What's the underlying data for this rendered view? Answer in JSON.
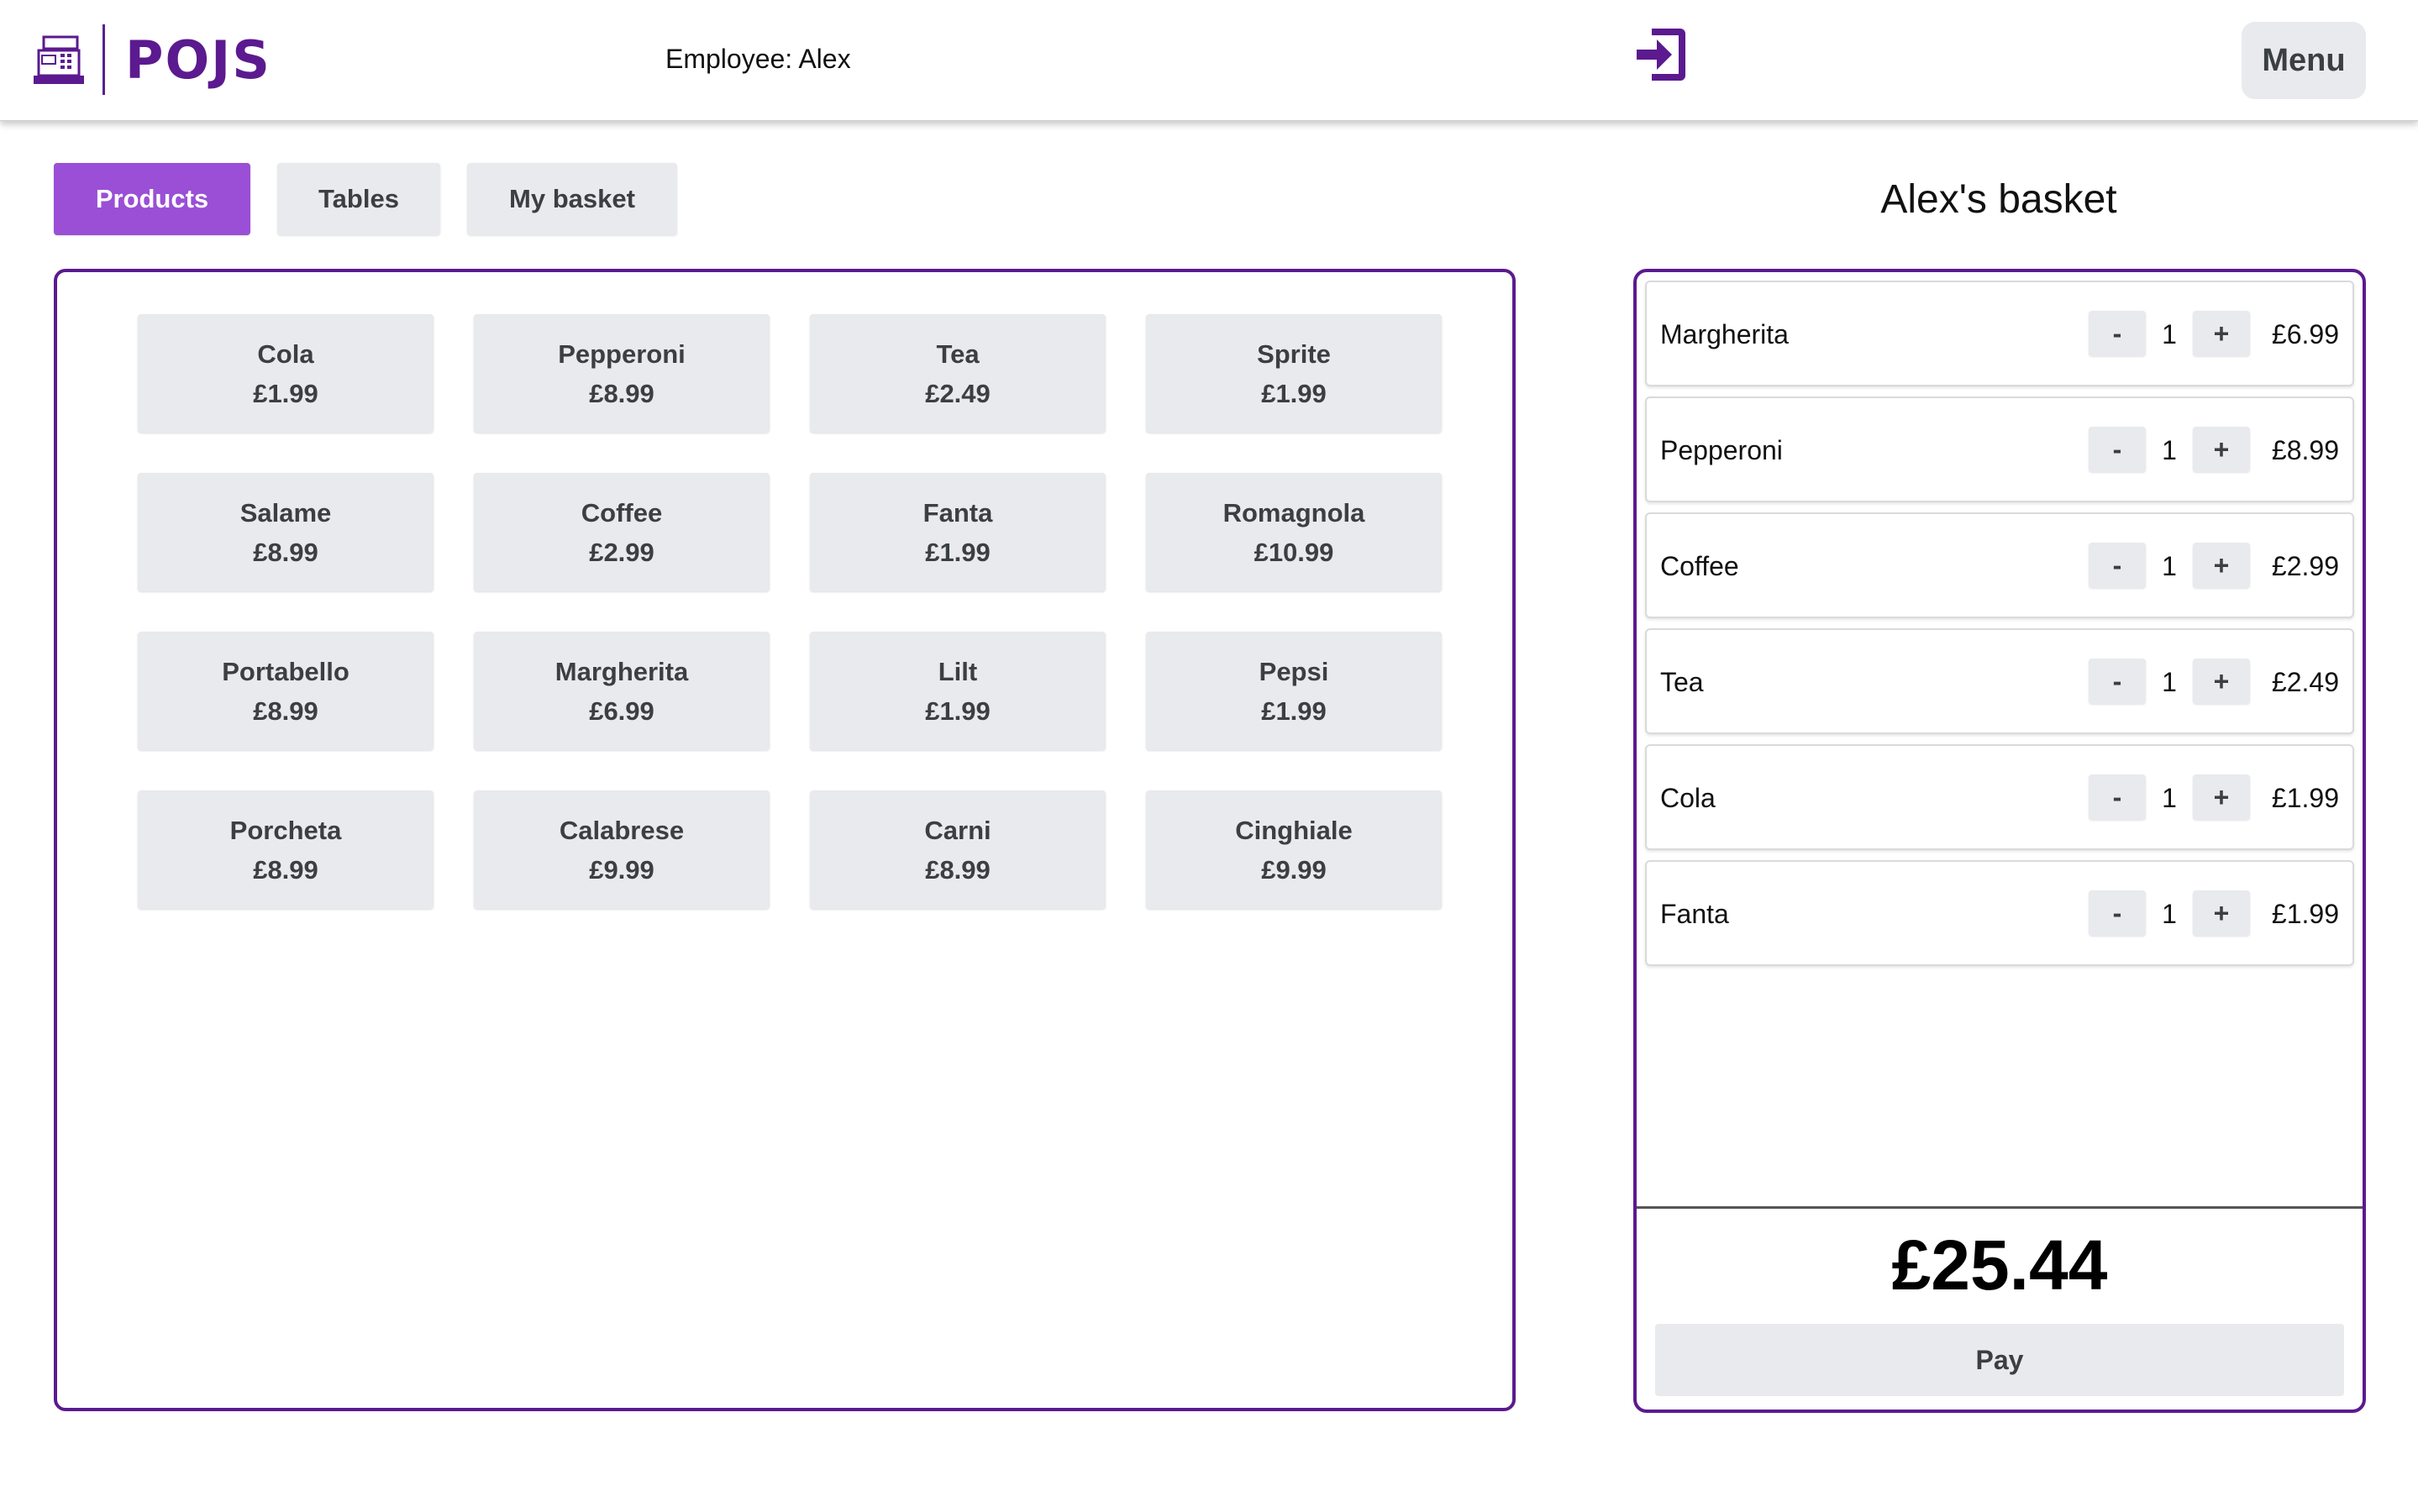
{
  "app": {
    "name": "POJS",
    "employee_label": "Employee: Alex",
    "menu_label": "Menu"
  },
  "colors": {
    "accent": "#9a4fd6",
    "brand": "#5b1a8f",
    "button_bg": "#e8eaed"
  },
  "tabs": [
    {
      "label": "Products",
      "active": true
    },
    {
      "label": "Tables",
      "active": false
    },
    {
      "label": "My basket",
      "active": false
    }
  ],
  "products": [
    {
      "name": "Cola",
      "price": "£1.99"
    },
    {
      "name": "Pepperoni",
      "price": "£8.99"
    },
    {
      "name": "Tea",
      "price": "£2.49"
    },
    {
      "name": "Sprite",
      "price": "£1.99"
    },
    {
      "name": "Salame",
      "price": "£8.99"
    },
    {
      "name": "Coffee",
      "price": "£2.99"
    },
    {
      "name": "Fanta",
      "price": "£1.99"
    },
    {
      "name": "Romagnola",
      "price": "£10.99"
    },
    {
      "name": "Portabello",
      "price": "£8.99"
    },
    {
      "name": "Margherita",
      "price": "£6.99"
    },
    {
      "name": "Lilt",
      "price": "£1.99"
    },
    {
      "name": "Pepsi",
      "price": "£1.99"
    },
    {
      "name": "Porcheta",
      "price": "£8.99"
    },
    {
      "name": "Calabrese",
      "price": "£9.99"
    },
    {
      "name": "Carni",
      "price": "£8.99"
    },
    {
      "name": "Cinghiale",
      "price": "£9.99"
    }
  ],
  "basket": {
    "title": "Alex's basket",
    "items": [
      {
        "name": "Margherita",
        "minus": "-",
        "qty": "1",
        "plus": "+",
        "price": "£6.99"
      },
      {
        "name": "Pepperoni",
        "minus": "-",
        "qty": "1",
        "plus": "+",
        "price": "£8.99"
      },
      {
        "name": "Coffee",
        "minus": "-",
        "qty": "1",
        "plus": "+",
        "price": "£2.99"
      },
      {
        "name": "Tea",
        "minus": "-",
        "qty": "1",
        "plus": "+",
        "price": "£2.49"
      },
      {
        "name": "Cola",
        "minus": "-",
        "qty": "1",
        "plus": "+",
        "price": "£1.99"
      },
      {
        "name": "Fanta",
        "minus": "-",
        "qty": "1",
        "plus": "+",
        "price": "£1.99"
      }
    ],
    "total": "£25.44",
    "pay_label": "Pay"
  },
  "icons": {
    "logo": "cash-register-icon",
    "logout": "sign-in-icon"
  }
}
